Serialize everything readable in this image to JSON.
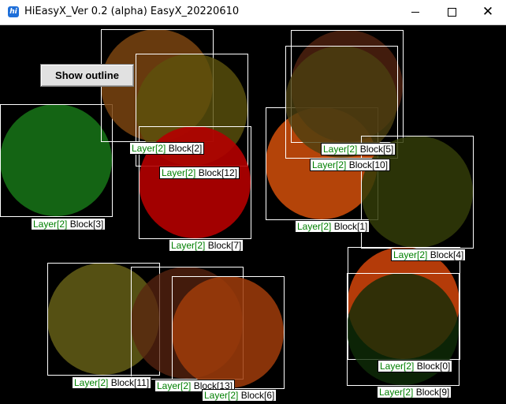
{
  "window": {
    "title": "HiEasyX_Ver 0.2 (alpha)  EasyX_20220610",
    "app_icon": "hi",
    "controls": {
      "minimize": "—",
      "maximize": "☐",
      "close": "✕"
    }
  },
  "toolbar": {
    "outline_button_label": "Show outline"
  },
  "blocks": [
    {
      "layer": "Layer[2]",
      "name": "Block[3]",
      "color": "#146414"
    },
    {
      "layer": "Layer[2]",
      "name": "Block[2]",
      "color": "#7A4410"
    },
    {
      "layer": "Layer[2]",
      "name": "Block[12]",
      "color": "#5C520C"
    },
    {
      "layer": "Layer[2]",
      "name": "Block[7]",
      "color": "#B40000"
    },
    {
      "layer": "Layer[2]",
      "name": "Block[1]",
      "color": "#C84B0A"
    },
    {
      "layer": "Layer[2]",
      "name": "Block[5]",
      "color": "#582512"
    },
    {
      "layer": "Layer[2]",
      "name": "Block[10]",
      "color": "#4B4010"
    },
    {
      "layer": "Layer[2]",
      "name": "Block[4]",
      "color": "#323C08"
    },
    {
      "layer": "Layer[2]",
      "name": "Block[0]",
      "color": "#C8410A"
    },
    {
      "layer": "Layer[2]",
      "name": "Block[9]",
      "color": "#0F2D08"
    },
    {
      "layer": "Layer[2]",
      "name": "Block[11]",
      "color": "#5A5414"
    },
    {
      "layer": "Layer[2]",
      "name": "Block[13]",
      "color": "#5A2410"
    },
    {
      "layer": "Layer[2]",
      "name": "Block[6]",
      "color": "#A03C0A"
    }
  ]
}
